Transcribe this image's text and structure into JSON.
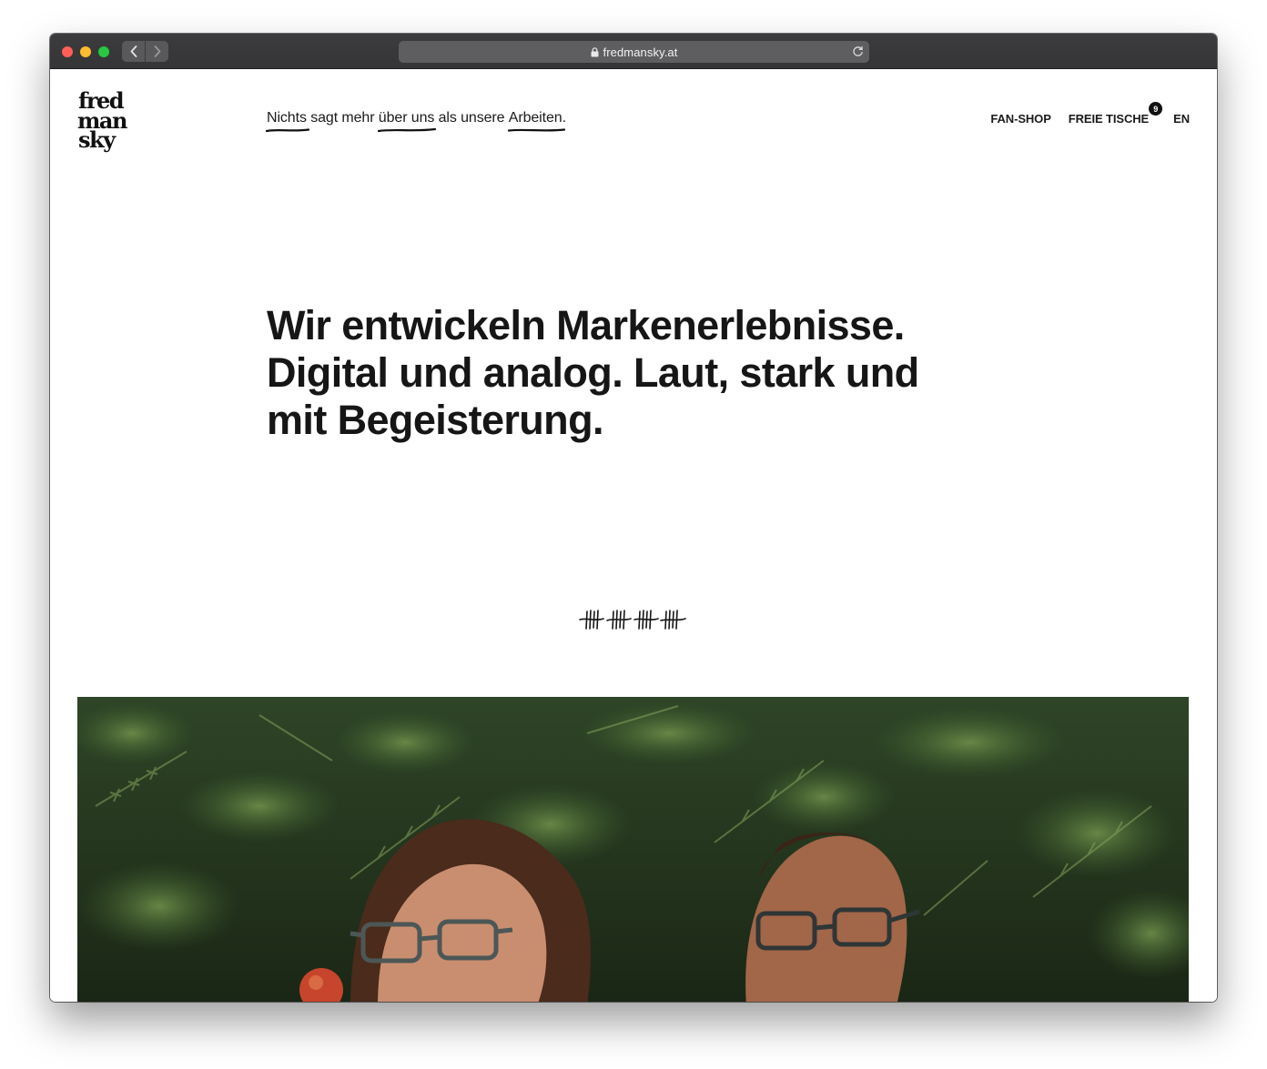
{
  "browser": {
    "url": "fredmansky.at",
    "icons": [
      "back-icon",
      "forward-icon",
      "lock-icon",
      "reload-icon"
    ]
  },
  "site": {
    "logo_text": [
      "fred",
      "man",
      "sky"
    ],
    "tagline": {
      "part1": "Nichts",
      "part2": " sagt mehr ",
      "part3": "über uns",
      "part4": " als unsere ",
      "part5": "Arbeiten",
      "part6": "."
    },
    "nav": {
      "fanshop": "FAN-SHOP",
      "tische": "FREIE TISCHE",
      "tische_badge": "9",
      "lang": "EN"
    },
    "headline": [
      "Wir entwickeln Markenerlebnisse.",
      "Digital und analog. Laut, stark und",
      "mit Begeisterung."
    ],
    "tally_icon": "tally-marks-icon",
    "hero_image": "photo of two people wearing glasses in front of green ferns",
    "colors": {
      "text": "#161616",
      "titlebar": "#38383a",
      "address_bar": "#5e5e60",
      "foliage_dark": "#1d2a18"
    }
  }
}
